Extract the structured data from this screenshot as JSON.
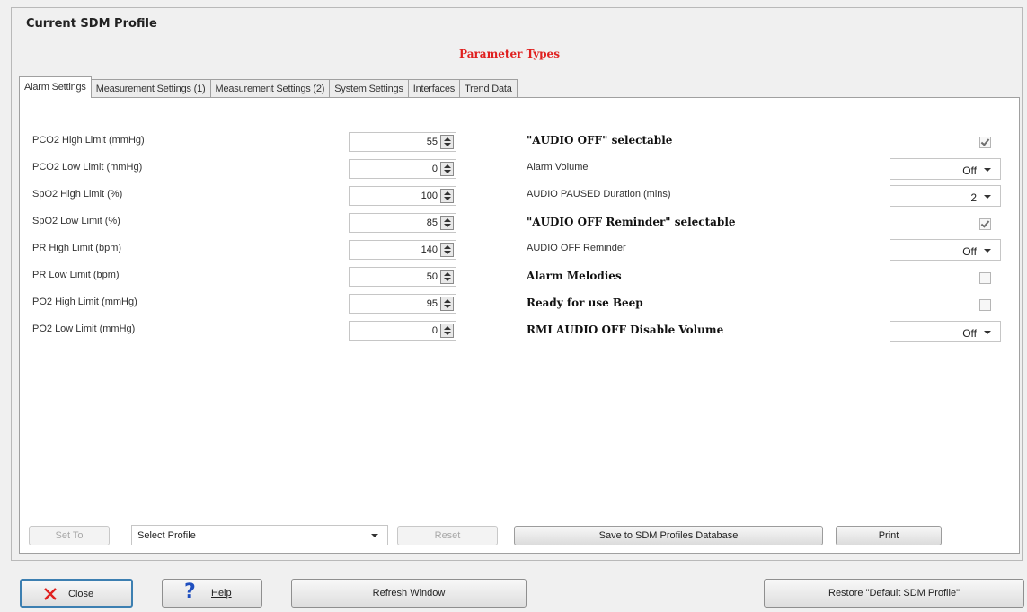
{
  "header": {
    "title": "Current SDM Profile",
    "subtitle": "Parameter Types"
  },
  "tabs": [
    {
      "label": "Alarm Settings",
      "active": true
    },
    {
      "label": "Measurement Settings (1)",
      "active": false
    },
    {
      "label": "Measurement Settings (2)",
      "active": false
    },
    {
      "label": "System Settings",
      "active": false
    },
    {
      "label": "Interfaces",
      "active": false
    },
    {
      "label": "Trend Data",
      "active": false
    }
  ],
  "limits": [
    {
      "label": "PCO2 High Limit (mmHg)",
      "value": "55"
    },
    {
      "label": "PCO2 Low Limit (mmHg)",
      "value": "0"
    },
    {
      "label": "SpO2 High Limit (%)",
      "value": "100"
    },
    {
      "label": "SpO2 Low Limit (%)",
      "value": "85"
    },
    {
      "label": "PR High Limit (bpm)",
      "value": "140"
    },
    {
      "label": "PR Low Limit (bpm)",
      "value": "50"
    },
    {
      "label": "PO2 High Limit (mmHg)",
      "value": "95"
    },
    {
      "label": "PO2 Low Limit (mmHg)",
      "value": "0"
    }
  ],
  "settings": [
    {
      "label": "\"AUDIO OFF\" selectable",
      "bold": true,
      "control": "checkbox",
      "checked": true
    },
    {
      "label": "Alarm Volume",
      "bold": false,
      "control": "select",
      "value": "Off"
    },
    {
      "label": "AUDIO PAUSED Duration (mins)",
      "bold": false,
      "control": "select",
      "value": "2"
    },
    {
      "label": "\"AUDIO OFF Reminder\" selectable",
      "bold": true,
      "control": "checkbox",
      "checked": true
    },
    {
      "label": "AUDIO OFF Reminder",
      "bold": false,
      "control": "select",
      "value": "Off"
    },
    {
      "label": "Alarm Melodies",
      "bold": true,
      "control": "checkbox",
      "checked": false
    },
    {
      "label": "Ready for use Beep",
      "bold": true,
      "control": "checkbox",
      "checked": false
    },
    {
      "label": "RMI AUDIO OFF Disable Volume",
      "bold": true,
      "control": "select",
      "value": "Off"
    }
  ],
  "profile_bar": {
    "set_to": "Set To",
    "select_profile": "Select Profile",
    "reset": "Reset",
    "save": "Save to SDM Profiles Database",
    "print": "Print"
  },
  "footer": {
    "close": "Close",
    "help": "Help",
    "refresh": "Refresh Window",
    "restore": "Restore \"Default SDM Profile\""
  },
  "colors": {
    "subtitle": "#e0201f",
    "close_icon": "#e0201f",
    "help_icon": "#1f4fbf"
  }
}
